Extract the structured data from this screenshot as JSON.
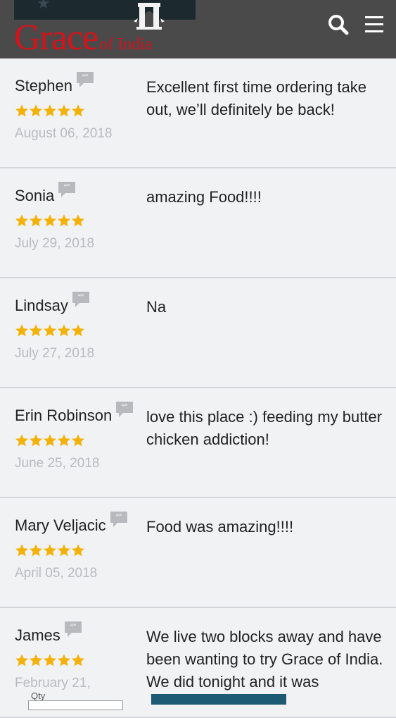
{
  "header": {
    "logo_main": "Grace",
    "logo_sub": "of India",
    "search_icon": "search-icon",
    "menu_icon": "hamburger-menu-icon",
    "background": "#4a4a4a",
    "logo_color": "#d6121a"
  },
  "reviews": [
    {
      "name": "Stephen",
      "rating": 5,
      "date": "August 06, 2018",
      "comment": "Excellent first time ordering take out, we’ll definitely be back!"
    },
    {
      "name": "Sonia",
      "rating": 5,
      "date": "July 29, 2018",
      "comment": "amazing Food!!!!"
    },
    {
      "name": "Lindsay",
      "rating": 5,
      "date": "July 27, 2018",
      "comment": "Na"
    },
    {
      "name": "Erin Robinson",
      "rating": 5,
      "date": "June 25, 2018",
      "comment": "love this place :) feeding my butter chicken addiction!"
    },
    {
      "name": "Mary Veljacic",
      "rating": 5,
      "date": "April 05, 2018",
      "comment": "Food was amazing!!!!"
    },
    {
      "name": "James",
      "rating": 5,
      "date": "February 21,",
      "comment": "We live two blocks away and have been wanting to try Grace of India. We did tonight and it was"
    }
  ],
  "bottom": {
    "label": "Qty"
  },
  "colors": {
    "star": "#f2b20a",
    "quote_icon": "#b7b9bd",
    "date": "#b8bbbf"
  }
}
